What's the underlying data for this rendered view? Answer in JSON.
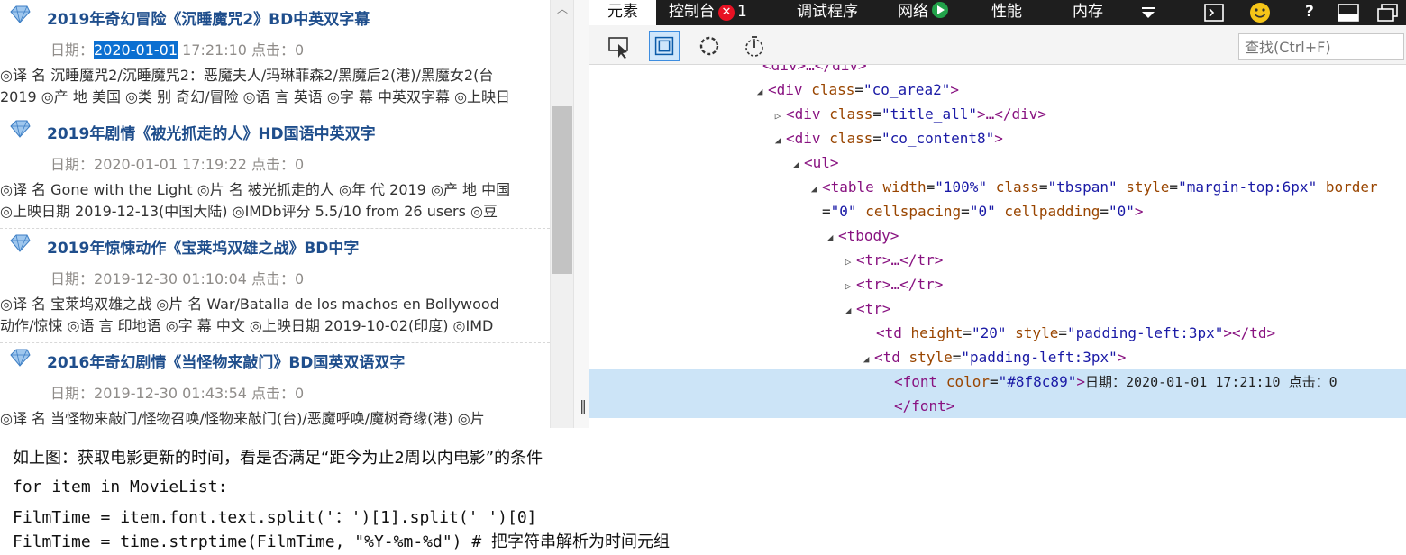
{
  "movies": [
    {
      "title": "2019年奇幻冒险《沉睡魔咒2》BD中英双字幕",
      "date_label": "日期：",
      "date_day": "2020-01-01",
      "date_time": " 17:21:10 点击：0",
      "desc1": "◎译 名 沉睡魔咒2/沉睡魔咒2：恶魔夫人/玛琳菲森2/黑魔后2(港)/黑魔女2(台",
      "desc2": "2019 ◎产 地 美国 ◎类 别 奇幻/冒险 ◎语 言 英语 ◎字 幕 中英双字幕 ◎上映日"
    },
    {
      "title": "2019年剧情《被光抓走的人》HD国语中英双字",
      "date_label": "日期：",
      "date_day": "2020-01-01",
      "date_time": " 17:19:22 点击：0",
      "desc1": "◎译 名 Gone with the Light ◎片 名 被光抓走的人 ◎年 代 2019 ◎产 地 中国",
      "desc2": "◎上映日期 2019-12-13(中国大陆) ◎IMDb评分 5.5/10 from 26 users ◎豆"
    },
    {
      "title": "2019年惊悚动作《宝莱坞双雄之战》BD中字",
      "date_label": "日期：",
      "date_day": "2019-12-30",
      "date_time": " 01:10:04 点击：0",
      "desc1": "◎译 名 宝莱坞双雄之战 ◎片 名 War/Batalla de los machos en Bollywood",
      "desc2": "动作/惊悚 ◎语 言 印地语 ◎字 幕 中文 ◎上映日期 2019-10-02(印度) ◎IMD"
    },
    {
      "title": "2016年奇幻剧情《当怪物来敲门》BD国英双语双字",
      "date_label": "日期：",
      "date_day": "2019-12-30",
      "date_time": " 01:43:54 点击：0",
      "desc1": "◎译 名 当怪物来敲门/怪物召唤/怪物来敲门(台)/恶魔呼唤/魔树奇缘(港) ◎片",
      "desc2": ""
    }
  ],
  "devtools": {
    "tabs": {
      "elements": "元素",
      "console": "控制台",
      "error_count": "1",
      "debugger": "调试程序",
      "network": "网络",
      "performance": "性能",
      "memory": "内存"
    },
    "search_placeholder": "查找(Ctrl+F)",
    "tree": {
      "l0_tag": "<div>…</div>",
      "l1_tag": "div",
      "l1_attr": "class",
      "l1_val": "co_area2",
      "l2_tag": "div",
      "l2_attr": "class",
      "l2_val": "title_all",
      "l2_tail": ">…</div>",
      "l3_tag": "div",
      "l3_attr": "class",
      "l3_val": "co_content8",
      "l4_tag": "<ul>",
      "l5_tag": "table",
      "l5_a1": "width",
      "l5_v1": "100%",
      "l5_a2": "class",
      "l5_v2": "tbspan",
      "l5_a3": "style",
      "l5_v3": "margin-top:6px",
      "l5_a4": "border",
      "l6_v4": "0",
      "l6_a5": "cellspacing",
      "l6_v5": "0",
      "l6_a6": "cellpadding",
      "l6_v6": "0",
      "l7_tag": "<tbody>",
      "l8_tag": "<tr>…</tr>",
      "l9_tag": "<tr>…</tr>",
      "l10_tag": "<tr>",
      "l11_tag": "td",
      "l11_a1": "height",
      "l11_v1": "20",
      "l11_a2": "style",
      "l11_v2": "padding-left:3px",
      "l11_tail": "></td>",
      "l12_tag": "td",
      "l12_a1": "style",
      "l12_v1": "padding-left:3px",
      "l13_tag": "font",
      "l13_a1": "color",
      "l13_v1": "#8f8c89",
      "l13_text": "日期：2020-01-01 17:21:10 点击：0",
      "l14_tag": "</font>"
    }
  },
  "caption": "如上图：获取电影更新的时间，看是否满足“距今为止2周以内电影”的条件",
  "code": [
    "for item in MovieList:",
    "  FilmTime = item.font.text.split('：')[1].split(' ')[0]",
    "  FilmTime = time.strptime(FilmTime, \"%Y-%m-%d\") # 把字符串解析为时间元组"
  ],
  "colors": {
    "title": "#1f4e8c",
    "date_meta": "#8f8c89",
    "selection": "#0b6fd1",
    "devtools_tab_bar": "#1e1e1e",
    "selected_node": "#cce4f7"
  }
}
